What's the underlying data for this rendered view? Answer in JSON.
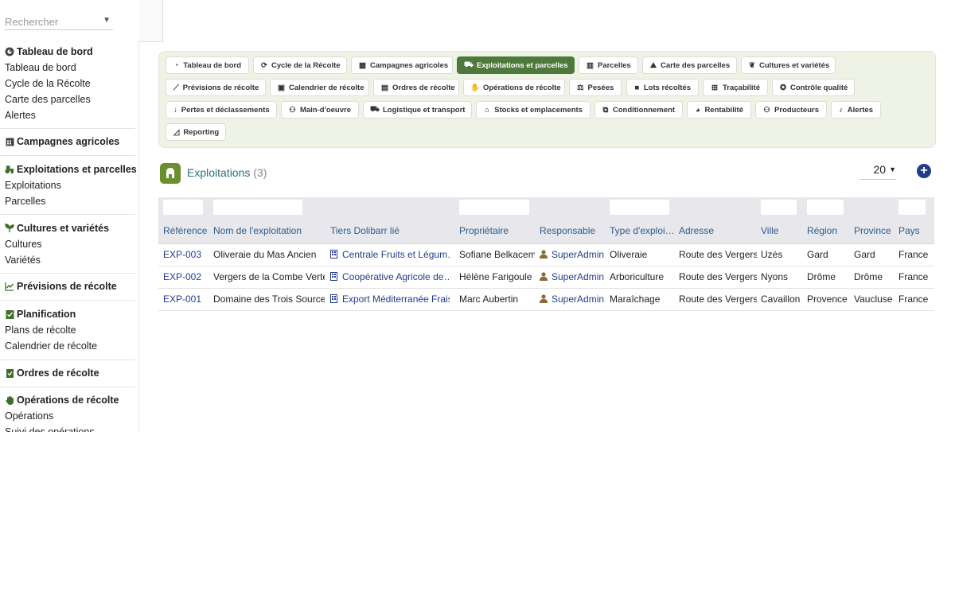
{
  "sidebar": {
    "search_placeholder": "Rechercher",
    "sections": [
      {
        "title": "Tableau de bord",
        "icon": "dashboard-icon",
        "items": [
          "Tableau de bord",
          "Cycle de la Récolte",
          "Carte des parcelles",
          "Alertes"
        ]
      },
      {
        "title": "Campagnes agricoles",
        "icon": "calendar-icon",
        "items": []
      },
      {
        "title": "Exploitations et parcelles",
        "icon": "tractor-icon",
        "items": [
          "Exploitations",
          "Parcelles"
        ]
      },
      {
        "title": "Cultures et variétés",
        "icon": "seedling-icon",
        "items": [
          "Cultures",
          "Variétés"
        ]
      },
      {
        "title": "Prévisions de récolte",
        "icon": "chart-line-icon",
        "items": []
      },
      {
        "title": "Planification",
        "icon": "clipboard-check-icon",
        "items": [
          "Plans de récolte",
          "Calendrier de récolte"
        ]
      },
      {
        "title": "Ordres de récolte",
        "icon": "clipboard-icon",
        "items": []
      },
      {
        "title": "Opérations de récolte",
        "icon": "hand-icon",
        "items": [
          "Opérations",
          "Suivi des opérations"
        ]
      }
    ]
  },
  "nav": {
    "buttons": [
      {
        "label": "Tableau de bord",
        "icon": "dashboard-icon",
        "active": false
      },
      {
        "label": "Cycle de la Récolte",
        "icon": "sync-icon",
        "active": false
      },
      {
        "label": "Campagnes agricoles",
        "icon": "calendar-icon",
        "active": false
      },
      {
        "label": "Exploitations et parcelles",
        "icon": "tractor-icon",
        "active": true
      },
      {
        "label": "Parcelles",
        "icon": "map-icon",
        "active": false
      },
      {
        "label": "Carte des parcelles",
        "icon": "map-marked-icon",
        "active": false
      },
      {
        "label": "Cultures et variétés",
        "icon": "seedling-icon",
        "active": false
      },
      {
        "label": "Prévisions de récolte",
        "icon": "chart-line-icon",
        "active": false
      },
      {
        "label": "Calendrier de récolte",
        "icon": "calendar-check-icon",
        "active": false
      },
      {
        "label": "Ordres de récolte",
        "icon": "clipboard-icon",
        "active": false
      },
      {
        "label": "Opérations de récolte",
        "icon": "hand-icon",
        "active": false
      },
      {
        "label": "Pesées",
        "icon": "balance-icon",
        "active": false
      },
      {
        "label": "Lots récoltés",
        "icon": "box-icon",
        "active": false
      },
      {
        "label": "Traçabilité",
        "icon": "sitemap-icon",
        "active": false
      },
      {
        "label": "Contrôle qualité",
        "icon": "award-icon",
        "active": false
      },
      {
        "label": "Pertes et déclassements",
        "icon": "arrow-down-icon",
        "active": false
      },
      {
        "label": "Main-d'oeuvre",
        "icon": "users-icon",
        "active": false
      },
      {
        "label": "Logistique et transport",
        "icon": "truck-icon",
        "active": false
      },
      {
        "label": "Stocks et emplacements",
        "icon": "warehouse-icon",
        "active": false
      },
      {
        "label": "Conditionnement",
        "icon": "boxes-icon",
        "active": false
      },
      {
        "label": "Rentabilité",
        "icon": "pie-chart-icon",
        "active": false
      },
      {
        "label": "Producteurs",
        "icon": "user-group-icon",
        "active": false
      },
      {
        "label": "Alertes",
        "icon": "bell-icon",
        "active": false
      },
      {
        "label": "Reporting",
        "icon": "chart-area-icon",
        "active": false
      }
    ]
  },
  "list": {
    "title": "Exploitations",
    "count": "(3)",
    "limit": "20",
    "columns": [
      "Référence",
      "Nom de l'exploitation",
      "Tiers Dolibarr lié",
      "Propriétaire",
      "Responsable",
      "Type d'exploi…",
      "Adresse",
      "Ville",
      "Région",
      "Province",
      "Pays"
    ],
    "rows": [
      {
        "ref": "EXP-003",
        "name": "Oliveraie du Mas Ancien",
        "tiers": "Centrale Fruits et Légum…",
        "owner": "Sofiane Belkacem",
        "manager": "SuperAdmin",
        "type": "Oliveraie",
        "address": "Route des Vergers",
        "city": "Uzès",
        "region": "Gard",
        "province": "Gard",
        "country": "France"
      },
      {
        "ref": "EXP-002",
        "name": "Vergers de la Combe Verte",
        "tiers": "Coopérative Agricole de…",
        "owner": "Hélène Farigoule",
        "manager": "SuperAdmin",
        "type": "Arboriculture",
        "address": "Route des Vergers",
        "city": "Nyons",
        "region": "Drôme",
        "province": "Drôme",
        "country": "France"
      },
      {
        "ref": "EXP-001",
        "name": "Domaine des Trois Sources",
        "tiers": "Export Méditerranée Frais",
        "owner": "Marc Aubertin",
        "manager": "SuperAdmin",
        "type": "Maraîchage",
        "address": "Route des Vergers",
        "city": "Cavaillon",
        "region": "Provence",
        "province": "Vaucluse",
        "country": "France"
      }
    ]
  },
  "colors": {
    "accent": "#4d7a3a",
    "link": "#223c8a",
    "title": "#2a6f80",
    "module_icon": "#6b8f2d"
  }
}
